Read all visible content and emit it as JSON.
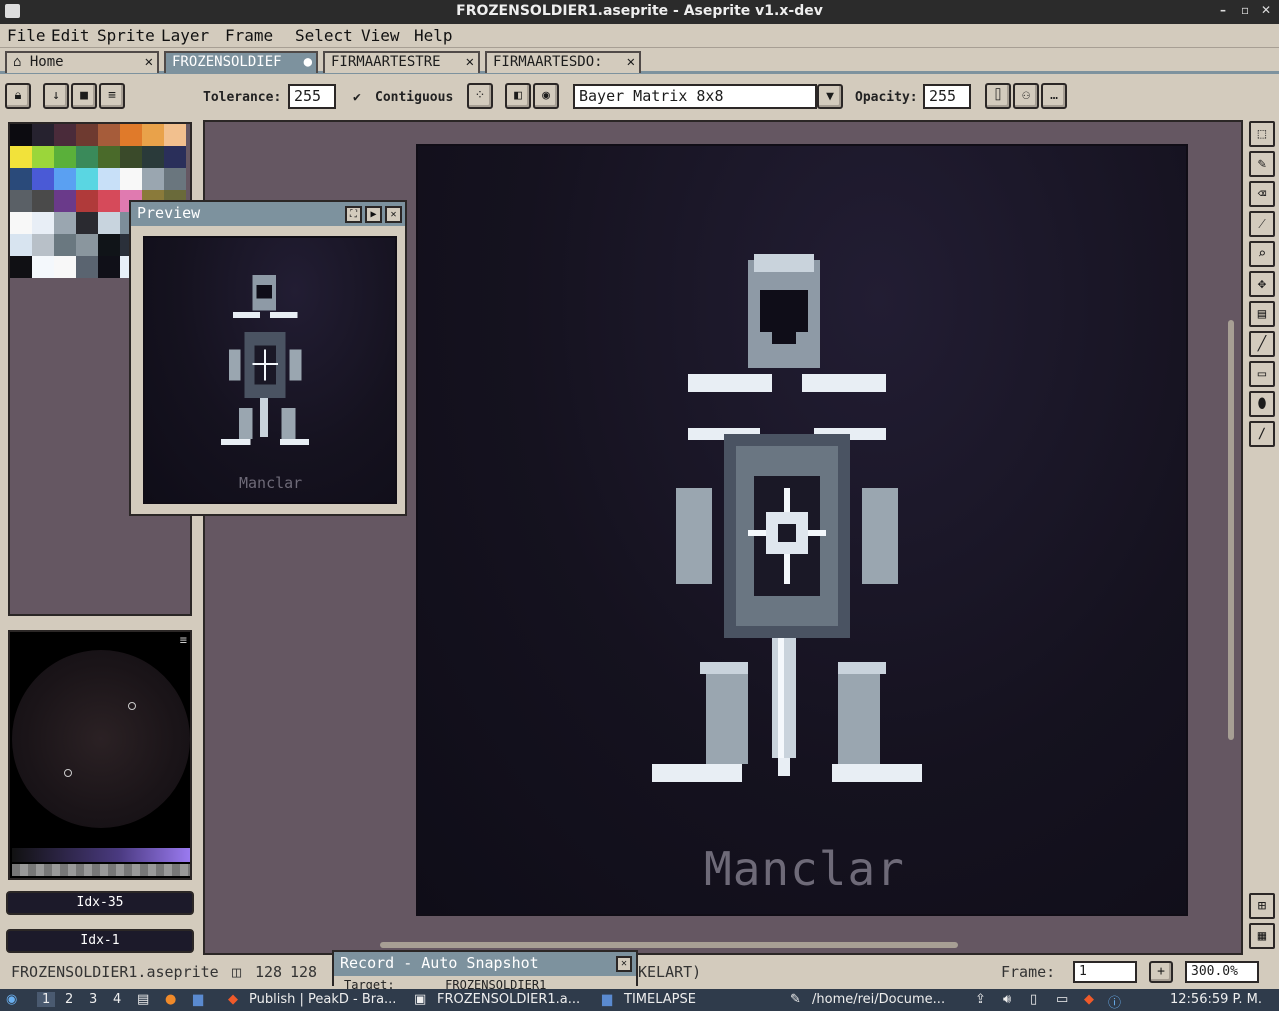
{
  "window": {
    "title": "FROZENSOLDIER1.aseprite - Aseprite v1.x-dev",
    "controls": [
      "–",
      "▫",
      "✕"
    ]
  },
  "menu": [
    "File",
    "Edit",
    "Sprite",
    "Layer",
    "Frame",
    "Select",
    "View",
    "Help"
  ],
  "tabs": [
    {
      "label": "Home",
      "close": "✕"
    },
    {
      "label": "FROZENSOLDIEF",
      "close": "●"
    },
    {
      "label": "FIRMAARTESTRE",
      "close": "✕"
    },
    {
      "label": "FIRMAARTESDO:",
      "close": "✕"
    }
  ],
  "toolbar": {
    "tolerance_label": "Tolerance:",
    "tolerance_value": "255",
    "contiguous_check": "✔",
    "contiguous_label": "Contiguous",
    "dither": "Bayer Matrix 8x8",
    "opacity_label": "Opacity:",
    "opacity_value": "255"
  },
  "palette_colors": [
    "#0c0b10",
    "#26222f",
    "#4a2b3a",
    "#6e3a30",
    "#a65c3a",
    "#e07a2a",
    "#e9a24a",
    "#f2c08e",
    "#f2e23a",
    "#9bd63a",
    "#5ab03a",
    "#3a8a5a",
    "#4a6a2a",
    "#3a4a2a",
    "#2a3a3a",
    "#2a2f5a",
    "#2a4a7a",
    "#4a5ad6",
    "#5aa0f2",
    "#5ad6e2",
    "#c8e0f8",
    "#f8f8f8",
    "#9aa6b0",
    "#6a767e",
    "#5a6066",
    "#4a4a4a",
    "#6a3a8a",
    "#b03a3a",
    "#d64a5a",
    "#e07ab0",
    "#8a7a3a",
    "#6a6a3a",
    "#f8f8f8",
    "#e8eef6",
    "#9aa6b0",
    "#2a2a30",
    "#c8d4de",
    "#7d8e9a",
    "#3a3f48",
    "#1a1a24",
    "#d8e4f0",
    "#b8c0c8",
    "#6a7880",
    "#8a969e",
    "#101418",
    "#2a303a",
    "#4a5058",
    "#e8eef6",
    "#101014",
    "#f4f8fc",
    "#f8f8f8",
    "#5a6470",
    "#101018",
    "#e8f0f8",
    "#f0f4f8",
    "#1c1c24"
  ],
  "color": {
    "fg_index": "Idx-35",
    "bg_index": "Idx-1"
  },
  "preview": {
    "title": "Preview",
    "buttons": [
      "⛶",
      "▶",
      "✕"
    ],
    "signature": "Manclar"
  },
  "sprite": {
    "signature": "Manclar"
  },
  "status": {
    "filename": "FROZENSOLDIER1.aseprite",
    "size_w": "128",
    "size_h": "128",
    "layer_tail": "KELART)",
    "frame_label": "Frame:",
    "frame_value": "1",
    "zoom": "300.0%"
  },
  "record": {
    "title": "Record - Auto Snapshot",
    "sub": "Target:       FROZENSOLDIER1"
  },
  "taskbar": {
    "workspaces": [
      "1",
      "2",
      "3",
      "4"
    ],
    "items": [
      "Publish | PeakD - Bra...",
      "FROZENSOLDIER1.a...",
      "TIMELAPSE",
      "/home/rei/Docume..."
    ],
    "clock": "12:56:59 P. M."
  }
}
